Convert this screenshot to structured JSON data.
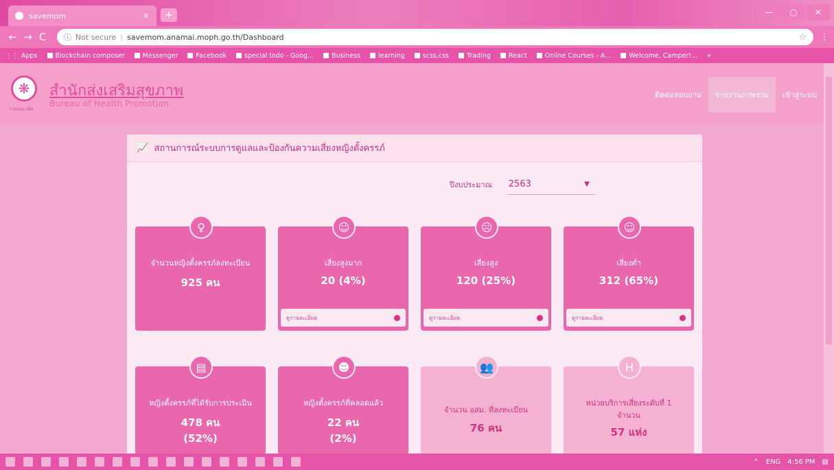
{
  "browser": {
    "tab_title": "savemom",
    "tab_close": "×",
    "new_tab": "+",
    "window_controls": [
      "—",
      "▢",
      "✕"
    ],
    "back": "←",
    "forward": "→",
    "reload": "C",
    "not_secure": "Not secure",
    "url": "savemom.anamai.moph.go.th/Dashboard",
    "bookmarks": [
      "Apps",
      "Blockchain composer",
      "Messenger",
      "Facebook",
      "special todo - Goog...",
      "Business",
      "learning",
      "scss,css",
      "Trading",
      "React",
      "Online Courses - A...",
      "Welcome, Camper!...",
      "»"
    ]
  },
  "site": {
    "brand_th": "สำนักส่งเสริมสุขภาพ",
    "brand_en": "Bureau of Health Promotion",
    "seal_caption": "กรมอนามัย",
    "nav": [
      "ติดต่อสอบถาม",
      "รายงานภาพรวม",
      "เข้าสู่ระบบ"
    ]
  },
  "dashboard": {
    "title": "สถานการณ์ระบบการดูแลและป้องกันความเสี่ยงหญิงตั้งครรภ์",
    "year_label": "ปีงบประมาณ",
    "year_value": "2563",
    "detail_link": "ดูรายละเอียด",
    "cards": [
      {
        "label": "จำนวนหญิงตั้งครรภ์ลงทะเบียน",
        "value": "925 คน",
        "value2": "",
        "icon": "pregnant-icon"
      },
      {
        "label": "เสี่ยงสูงมาก",
        "value": "20 (4%)",
        "value2": "",
        "icon": "face-icon"
      },
      {
        "label": "เสี่ยงสูง",
        "value": "120 (25%)",
        "value2": "",
        "icon": "face-icon"
      },
      {
        "label": "เสี่ยงต่ำ",
        "value": "312 (65%)",
        "value2": "",
        "icon": "face-icon"
      },
      {
        "label": "หญิงตั้งครรภ์ที่ได้รับการประเมิน",
        "value": "478 คน",
        "value2": "(52%)",
        "icon": "document-icon"
      },
      {
        "label": "หญิงตั้งครรภ์ที่คลอดแล้ว",
        "value": "22 คน",
        "value2": "(2%)",
        "icon": "baby-icon"
      },
      {
        "label": "จำนวน อสม. ที่ลงทะเบียน",
        "value": "76 คน",
        "value2": "",
        "icon": "group-icon"
      },
      {
        "label": "หน่วยบริการเสี่ยงระดับที่ 1",
        "label2": "จำนวน",
        "value": "57 แห่ง",
        "value2": "",
        "icon": "hospital-icon"
      }
    ]
  },
  "taskbar": {
    "tray_lang": "ENG",
    "tray_time": "4:56 PM"
  }
}
